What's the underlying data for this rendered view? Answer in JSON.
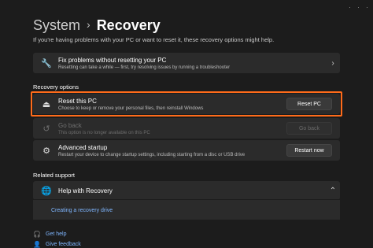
{
  "header": {
    "crumb": "System",
    "separator": "›",
    "title": "Recovery"
  },
  "subtitle": "If you're having problems with your PC or want to reset it, these recovery options might help.",
  "fix_card": {
    "icon": "wrench-icon",
    "title": "Fix problems without resetting your PC",
    "desc": "Resetting can take a while — first, try resolving issues by running a troubleshooter",
    "chevron": "›"
  },
  "recovery_options_label": "Recovery options",
  "reset_card": {
    "icon": "reset-pc-icon",
    "title": "Reset this PC",
    "desc": "Choose to keep or remove your personal files, then reinstall Windows",
    "button": "Reset PC"
  },
  "goback_card": {
    "icon": "history-icon",
    "title": "Go back",
    "desc": "This option is no longer available on this PC",
    "button": "Go back"
  },
  "advanced_card": {
    "icon": "advanced-startup-icon",
    "title": "Advanced startup",
    "desc": "Restart your device to change startup settings, including starting from a disc or USB drive",
    "button": "Restart now"
  },
  "related_support_label": "Related support",
  "help_card": {
    "icon": "globe-icon",
    "title": "Help with Recovery",
    "chevron": "⌃",
    "link": "Creating a recovery drive"
  },
  "footer": {
    "get_help": "Get help",
    "give_feedback": "Give feedback"
  },
  "colors": {
    "accent_outline": "#ff6b1a",
    "link": "#7fb6ff",
    "card": "#2b2b2b",
    "background": "#1c1c1c"
  }
}
